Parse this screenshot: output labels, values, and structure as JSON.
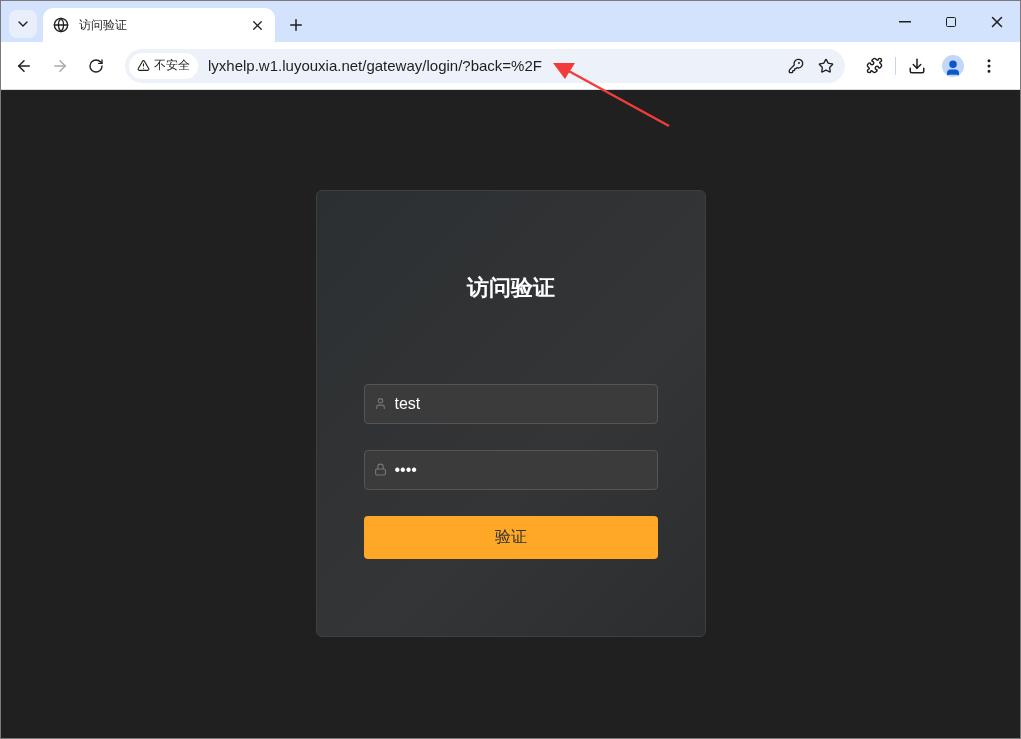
{
  "browser": {
    "tabs": [
      {
        "title": "访问验证",
        "selected": true
      }
    ],
    "security_label": "不安全",
    "url": "lyxhelp.w1.luyouxia.net/gateway/login/?back=%2F"
  },
  "login": {
    "title": "访问验证",
    "username": {
      "value": "test"
    },
    "password": {
      "value": "••••"
    },
    "submit": "验证"
  }
}
